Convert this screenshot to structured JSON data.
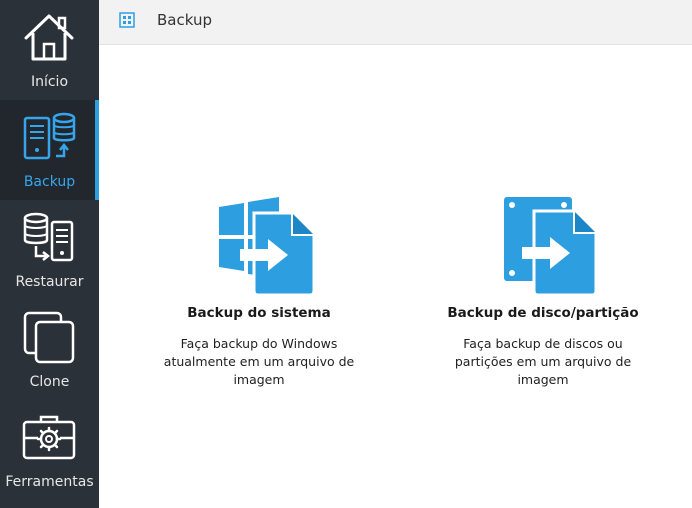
{
  "sidebar": {
    "items": [
      {
        "label": "Início",
        "icon": "home-icon",
        "active": false
      },
      {
        "label": "Backup",
        "icon": "backup-icon",
        "active": true
      },
      {
        "label": "Restaurar",
        "icon": "restore-icon",
        "active": false
      },
      {
        "label": "Clone",
        "icon": "clone-icon",
        "active": false
      },
      {
        "label": "Ferramentas",
        "icon": "toolbox-icon",
        "active": false
      }
    ]
  },
  "header": {
    "title": "Backup",
    "icon": "grid-icon"
  },
  "cards": [
    {
      "title": "Backup do sistema",
      "description": "Faça backup do Windows atualmente em um arquivo de imagem",
      "icon": "system-backup-icon"
    },
    {
      "title": "Backup de disco/partição",
      "description": "Faça backup de discos ou partições em um arquivo de imagem",
      "icon": "disk-backup-icon"
    }
  ],
  "colors": {
    "accent": "#2d9fe0",
    "sidebar_bg": "#2b3138",
    "active_label": "#36a6ec"
  }
}
